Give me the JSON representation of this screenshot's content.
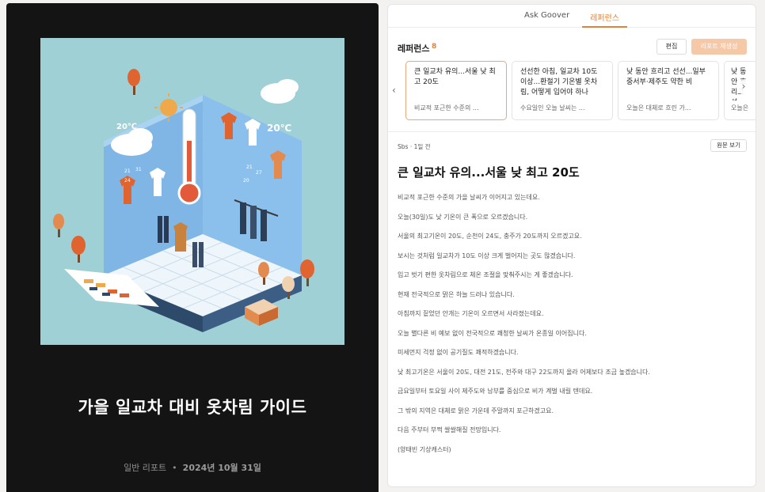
{
  "cover": {
    "title": "가을 일교차 대비 옷차림 가이드",
    "category": "일반 리포트",
    "separator": "•",
    "date": "2024년 10월 31일",
    "illustration_text": {
      "left_temp": "20℃",
      "right_temp": "20℃",
      "small_temps": [
        "21",
        "31",
        "24",
        "21",
        "27",
        "20"
      ]
    }
  },
  "tabs": [
    {
      "label": "Ask Goover",
      "active": false
    },
    {
      "label": "레퍼런스",
      "active": true
    }
  ],
  "references": {
    "title": "레퍼런스",
    "count": "8",
    "edit_label": "편집",
    "regenerate_label": "리포트 재생성",
    "prev_icon": "‹",
    "next_icon": "›",
    "cards": [
      {
        "title": "큰 일교차 유의...서울 낮 최고 20도",
        "snippet": "비교적 포근한 수준의 ...",
        "selected": true
      },
      {
        "title": "선선한 아침, 일교차 10도 이상...환절기 기온별 옷차림, 어떻게 입어야 하나",
        "snippet": "수요일인 오늘 날씨는 ...",
        "selected": false
      },
      {
        "title": "낮 동안 흐리고 선선...일부 중서부·제주도 약한 비",
        "snippet": "오늘은 대체로 흐린 가...",
        "selected": false
      },
      {
        "title": "낮 동안 흐리고 선선...일부 중서부",
        "snippet": "오늘은 ...",
        "selected": false
      }
    ]
  },
  "article": {
    "source": "Sbs · 1일 전",
    "view_original_label": "원문 보기",
    "title": "큰 일교차 유의...서울 낮 최고 20도",
    "paragraphs": [
      "비교적 포근한 수준의 가을 날씨가 이어지고 있는데요.",
      "오늘(30일)도 낮 기온이 큰 폭으로 오르겠습니다.",
      "서울의 최고기온이 20도, 순천이 24도, 충주가 20도까지 오르겠고요.",
      "보시는 것처럼 일교차가 10도 이상 크게 벌어지는 곳도 많겠습니다.",
      "입고 벗기 편한 옷차림으로 체온 조절을 맞춰주시는 게 좋겠습니다.",
      "현재 전국적으로 맑은 하늘 드러나 있습니다.",
      "아침까지 짙었던 안개는 기온이 오르면서 사라졌는데요.",
      "오늘 별다른 비 예보 없이 전국적으로 쾌청한 날씨가 온종일 이어집니다.",
      "미세먼지 걱정 없이 공기질도 쾌적하겠습니다.",
      "낮 최고기온은 서울이 20도, 대전 21도, 전주와 대구 22도까지 올라 어제보다 조금 높겠습니다.",
      "금요일부터 토요일 사이 제주도와 남부를 중심으로 비가 계벌 내릴 텐데요.",
      "그 밖의 지역은 대체로 맑은 가운데 주말까지 포근하겠고요.",
      "다음 주부터 부쩍 쌀쌀해질 전망입니다.",
      "(양태빈 기상캐스터)"
    ]
  },
  "colors": {
    "accent": "#e0823c",
    "accent_light": "#f5c8a8",
    "cover_bg": "#141414"
  }
}
